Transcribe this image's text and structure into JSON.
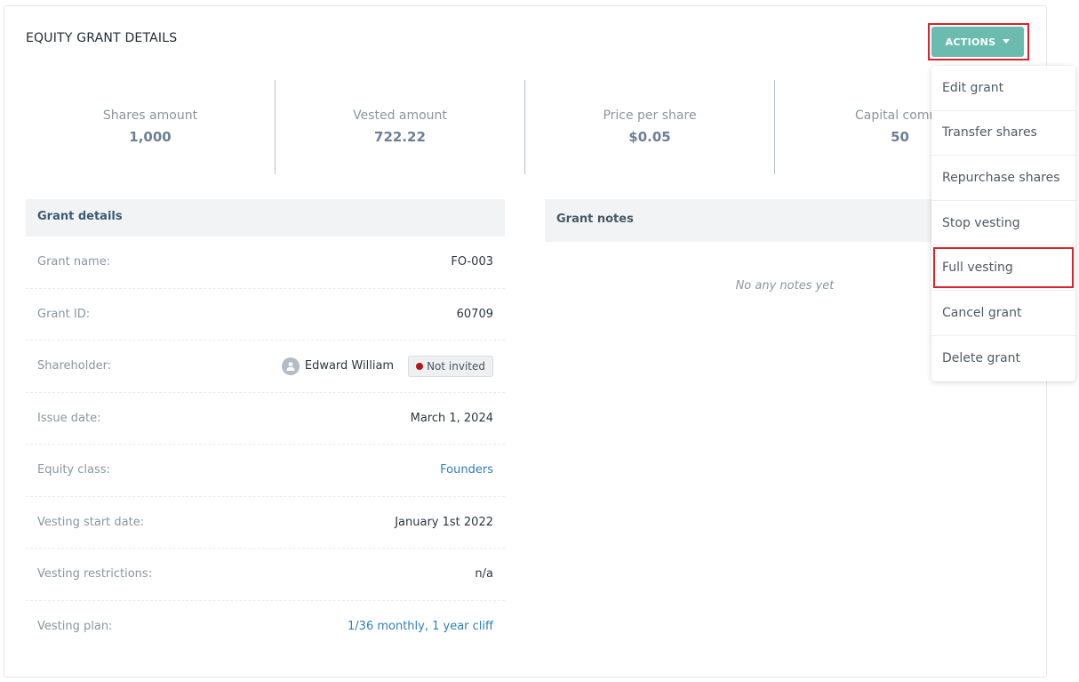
{
  "card": {
    "title": "EQUITY GRANT DETAILS"
  },
  "actions": {
    "label": "ACTIONS"
  },
  "stats": [
    {
      "label": "Shares amount",
      "value": "1,000"
    },
    {
      "label": "Vested amount",
      "value": "722.22"
    },
    {
      "label": "Price per share",
      "value": "$0.05"
    },
    {
      "label": "Capital commi",
      "value": "50"
    }
  ],
  "grant_details": {
    "title": "Grant details",
    "rows": [
      {
        "label": "Grant name:",
        "value": "FO-003"
      },
      {
        "label": "Grant ID:",
        "value": "60709"
      },
      {
        "label": "Shareholder:",
        "value": "Edward William",
        "badge": "Not invited"
      },
      {
        "label": "Issue date:",
        "value": "March 1, 2024"
      },
      {
        "label": "Equity class:",
        "value": "Founders"
      },
      {
        "label": "Vesting start date:",
        "value": "January 1st 2022"
      },
      {
        "label": "Vesting restrictions:",
        "value": "n/a"
      },
      {
        "label": "Vesting plan:",
        "value": "1/36 monthly, 1 year cliff"
      }
    ]
  },
  "grant_notes": {
    "title": "Grant notes",
    "empty": "No any notes yet"
  },
  "menu": {
    "items": [
      {
        "label": "Edit grant"
      },
      {
        "label": "Transfer shares"
      },
      {
        "label": "Repurchase shares"
      },
      {
        "label": "Stop vesting"
      },
      {
        "label": "Full vesting"
      },
      {
        "label": "Cancel grant"
      },
      {
        "label": "Delete grant"
      }
    ]
  },
  "colors": {
    "accent": "#6bbcae",
    "highlight": "#d9232d",
    "link": "#2f7fb8",
    "status_dot": "#b3161d"
  }
}
